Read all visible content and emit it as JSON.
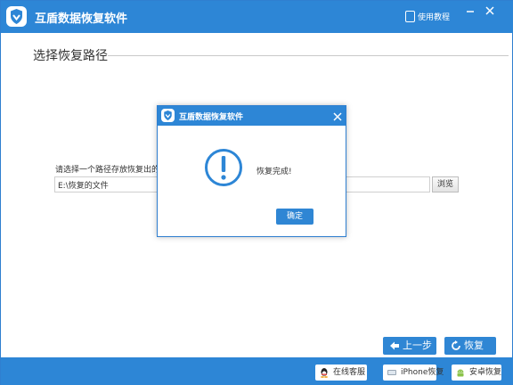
{
  "colors": {
    "brand_blue": "#2d86d6",
    "button_blue": "#2f86d4",
    "text": "#333333",
    "rule": "#c9c9c9"
  },
  "titlebar": {
    "title": "互盾数据恢复软件",
    "help_label": "使用教程",
    "icons": [
      "shield-logo-icon",
      "book-icon",
      "minimize-icon",
      "close-icon"
    ]
  },
  "main": {
    "section_title": "选择恢复路径",
    "path_label": "请选择一个路径存放恢复出的文件",
    "path_value": "E:\\恢复的文件",
    "browse_label": "浏览",
    "back_label": "上一步",
    "recover_label": "恢复"
  },
  "bottombar": {
    "items": [
      {
        "label": "在线客服",
        "icon": "qq-icon"
      },
      {
        "label": "iPhone恢复",
        "icon": "phone-icon"
      },
      {
        "label": "安卓恢复",
        "icon": "android-icon"
      }
    ]
  },
  "modal": {
    "title": "互盾数据恢复软件",
    "message": "恢复完成!",
    "ok_label": "确定",
    "icons": [
      "shield-logo-icon",
      "close-icon",
      "exclamation-icon"
    ]
  }
}
